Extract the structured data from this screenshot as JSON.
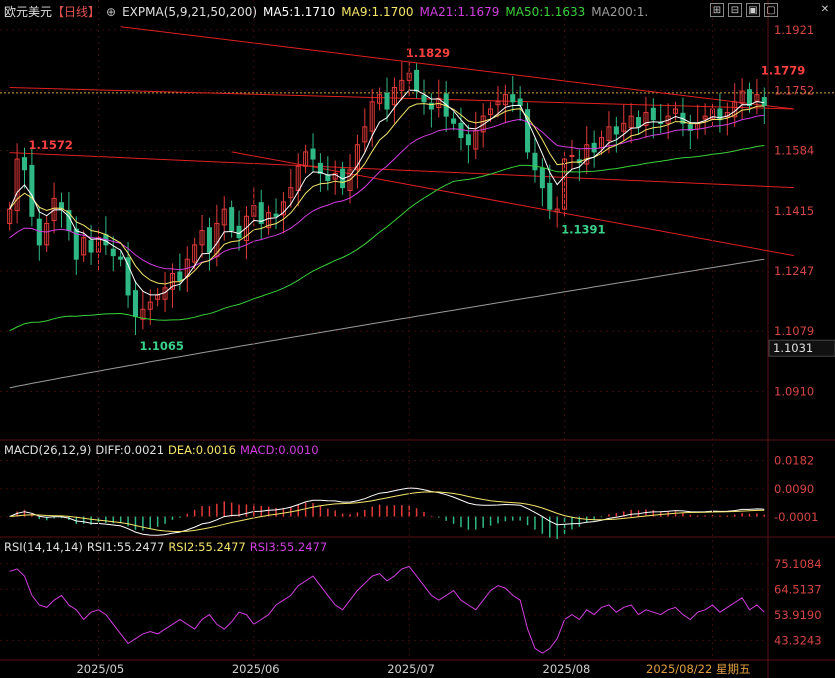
{
  "header": {
    "symbol": "欧元美元",
    "period": "【日线】",
    "circle": "⊕",
    "indicator": "EXPMA(5,9,21,50,200)",
    "ma5": "MA5:1.1710",
    "ma9": "MA9:1.1700",
    "ma21": "MA21:1.1679",
    "ma50": "MA50:1.1633",
    "ma200": "MA200:1."
  },
  "toolbar": {
    "btn1": "⊞",
    "btn2": "⊟",
    "btn3": "▣",
    "btn4": "▢",
    "btn5": "✕"
  },
  "colors": {
    "up": "#e23a3a",
    "down": "#2fb885",
    "ma5": "#ffffff",
    "ma9": "#f5e66a",
    "ma21": "#d23ee0",
    "ma50": "#3ad13a",
    "ma200": "#9b9b9b",
    "channel": "#e02020",
    "grid": "#3a0c0c",
    "axis_text": "#d64545",
    "rsi": "#d23ee0"
  },
  "chart_data": {
    "type": "candlestick",
    "price_axis": {
      "ticks": [
        "1.1921",
        "1.1752",
        "1.1584",
        "1.1415",
        "1.1247",
        "1.1079",
        "1.0910"
      ],
      "range": [
        1.078,
        1.196
      ],
      "last_price": "1.1031",
      "dashed_level": 1.1745
    },
    "x_axis": {
      "labels": [
        "2025/05",
        "2025/06",
        "2025/07",
        "2025/08",
        "2025/08/22 星期五"
      ],
      "label_index": [
        12,
        33,
        54,
        75,
        95
      ]
    },
    "annotations": [
      {
        "text": "1.1572",
        "index": 2,
        "value": 1.1572,
        "color": "#ff4040"
      },
      {
        "text": "1.1065",
        "index": 17,
        "value": 1.1065,
        "color": "#3ad18a"
      },
      {
        "text": "1.1829",
        "index": 53,
        "value": 1.1829,
        "color": "#ff4040"
      },
      {
        "text": "1.1391",
        "index": 74,
        "value": 1.1391,
        "color": "#3ad18a"
      },
      {
        "text": "1.1779",
        "index": 101,
        "value": 1.1779,
        "color": "#ff4040"
      }
    ],
    "close": [
      1.142,
      1.156,
      1.153,
      1.14,
      1.132,
      1.138,
      1.145,
      1.142,
      1.136,
      1.128,
      1.134,
      1.13,
      1.134,
      1.132,
      1.129,
      1.128,
      1.118,
      1.112,
      1.114,
      1.116,
      1.118,
      1.12,
      1.124,
      1.122,
      1.128,
      1.132,
      1.136,
      1.13,
      1.138,
      1.142,
      1.136,
      1.134,
      1.14,
      1.143,
      1.138,
      1.141,
      1.14,
      1.144,
      1.148,
      1.154,
      1.158,
      1.156,
      1.152,
      1.15,
      1.152,
      1.148,
      1.153,
      1.16,
      1.165,
      1.172,
      1.174,
      1.17,
      1.176,
      1.178,
      1.18,
      1.175,
      1.172,
      1.17,
      1.173,
      1.168,
      1.166,
      1.162,
      1.16,
      1.164,
      1.168,
      1.17,
      1.172,
      1.174,
      1.172,
      1.171,
      1.158,
      1.153,
      1.148,
      1.142,
      1.142,
      1.156,
      1.157,
      1.155,
      1.16,
      1.158,
      1.162,
      1.165,
      1.163,
      1.166,
      1.168,
      1.165,
      1.169,
      1.167,
      1.166,
      1.168,
      1.17,
      1.166,
      1.164,
      1.166,
      1.168,
      1.17,
      1.167,
      1.169,
      1.172,
      1.175,
      1.171,
      1.174,
      1.171
    ],
    "ma_last": {
      "ma5": 1.171,
      "ma9": 1.17,
      "ma21": 1.1679,
      "ma50": 1.1633
    },
    "ma200_start": 1.092,
    "ma200_end": 1.128,
    "channel_lines": [
      {
        "from": [
          0,
          1.176
        ],
        "to": [
          106,
          1.17
        ]
      },
      {
        "from": [
          0,
          1.1578
        ],
        "to": [
          106,
          1.148
        ]
      },
      {
        "from": [
          30,
          1.158
        ],
        "to": [
          106,
          1.129
        ]
      },
      {
        "from": [
          15,
          1.193
        ],
        "to": [
          106,
          1.17
        ]
      }
    ],
    "macd": {
      "label": "MACD(26,12,9)",
      "diff": "DIFF:0.0021",
      "dea": "DEA:0.0016",
      "macd": "MACD:0.0010",
      "ticks": [
        "0.0182",
        "0.0090",
        "-0.0001"
      ],
      "range": [
        -0.006,
        0.02
      ]
    },
    "rsi": {
      "label": "RSI(14,14,14)",
      "rsi1": "RSI1:55.2477",
      "rsi2": "RSI2:55.2477",
      "rsi3": "RSI3:55.2477",
      "ticks": [
        "75.1084",
        "64.5137",
        "53.9190",
        "43.3243"
      ],
      "range": [
        36,
        80
      ],
      "values": [
        72,
        73,
        70,
        62,
        58,
        57,
        60,
        62,
        58,
        56,
        52,
        55,
        56,
        54,
        50,
        46,
        42,
        44,
        46,
        47,
        46,
        48,
        50,
        52,
        50,
        48,
        52,
        54,
        50,
        48,
        51,
        55,
        54,
        50,
        52,
        54,
        58,
        60,
        62,
        66,
        68,
        70,
        66,
        62,
        58,
        56,
        60,
        64,
        67,
        70,
        71,
        68,
        70,
        73,
        74,
        70,
        66,
        62,
        60,
        62,
        64,
        60,
        58,
        56,
        60,
        64,
        66,
        65,
        62,
        60,
        48,
        40,
        38,
        40,
        44,
        52,
        54,
        52,
        56,
        54,
        57,
        58,
        55,
        57,
        58,
        54,
        56,
        55,
        54,
        56,
        57,
        54,
        52,
        55,
        56,
        58,
        55,
        57,
        59,
        61,
        56,
        58,
        55
      ]
    }
  }
}
